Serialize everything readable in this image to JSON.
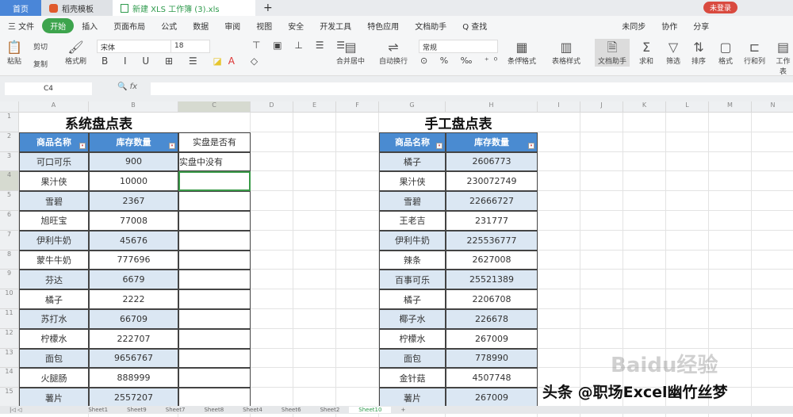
{
  "tabs": {
    "home": "首页",
    "docs": "稻壳模板",
    "workbook": "新建 XLS 工作簿 (3).xls",
    "login": "未登录"
  },
  "menu": [
    "三 文件",
    "开始",
    "插入",
    "页面布局",
    "公式",
    "数据",
    "审阅",
    "视图",
    "安全",
    "开发工具",
    "特色应用",
    "文档助手",
    "Q 查找",
    "未同步",
    "协作",
    "分享"
  ],
  "ribbon": {
    "paste": "粘贴",
    "cut": "剪切",
    "copy": "复制",
    "format_painter": "格式刷",
    "font": "宋体",
    "size": "18",
    "merge": "合并居中",
    "wrap": "自动换行",
    "numfmt": "常规",
    "cond": "条件格式",
    "table_style": "表格样式",
    "doc_helper": "文档助手",
    "sum": "求和",
    "filter": "筛选",
    "sort": "排序",
    "format": "格式",
    "rowcol": "行和列",
    "sheet": "工作表"
  },
  "formula_bar": {
    "cell_ref": "C4",
    "fx": "fx",
    "value": ""
  },
  "columns": [
    "A",
    "B",
    "C",
    "D",
    "E",
    "F",
    "G",
    "H",
    "I",
    "J",
    "K",
    "L",
    "M",
    "N"
  ],
  "system_table": {
    "title": "系统盘点表",
    "headers": [
      "商品名称",
      "库存数量"
    ],
    "extra_header": "实盘是否有",
    "extra_c3": "实盘中没有",
    "rows": [
      [
        "可口可乐",
        "900"
      ],
      [
        "果汁侠",
        "10000"
      ],
      [
        "雪碧",
        "2367"
      ],
      [
        "旭旺宝",
        "77008"
      ],
      [
        "伊利牛奶",
        "45676"
      ],
      [
        "蒙牛牛奶",
        "777696"
      ],
      [
        "芬达",
        "6679"
      ],
      [
        "橘子",
        "2222"
      ],
      [
        "苏打水",
        "66709"
      ],
      [
        "柠檬水",
        "222707"
      ],
      [
        "面包",
        "9656767"
      ],
      [
        "火腿肠",
        "888999"
      ],
      [
        "薯片",
        "2557207"
      ]
    ]
  },
  "manual_table": {
    "title": "手工盘点表",
    "headers": [
      "商品名称",
      "库存数量"
    ],
    "rows": [
      [
        "橘子",
        "2606773"
      ],
      [
        "果汁侠",
        "230072749"
      ],
      [
        "雪碧",
        "22666727"
      ],
      [
        "王老吉",
        "231777"
      ],
      [
        "伊利牛奶",
        "225536777"
      ],
      [
        "辣条",
        "2627008"
      ],
      [
        "百事可乐",
        "25521389"
      ],
      [
        "橘子",
        "2206708"
      ],
      [
        "椰子水",
        "226678"
      ],
      [
        "柠檬水",
        "267009"
      ],
      [
        "面包",
        "778990"
      ],
      [
        "金针菇",
        "4507748"
      ],
      [
        "薯片",
        "267009"
      ]
    ]
  },
  "sheets": [
    "Sheet1",
    "Sheet9",
    "Sheet7",
    "Sheet8",
    "Sheet4",
    "Sheet6",
    "Sheet2",
    "Sheet10"
  ],
  "watermark": "头条 @职场Excel幽竹丝梦",
  "baidu": "Baidu经验"
}
